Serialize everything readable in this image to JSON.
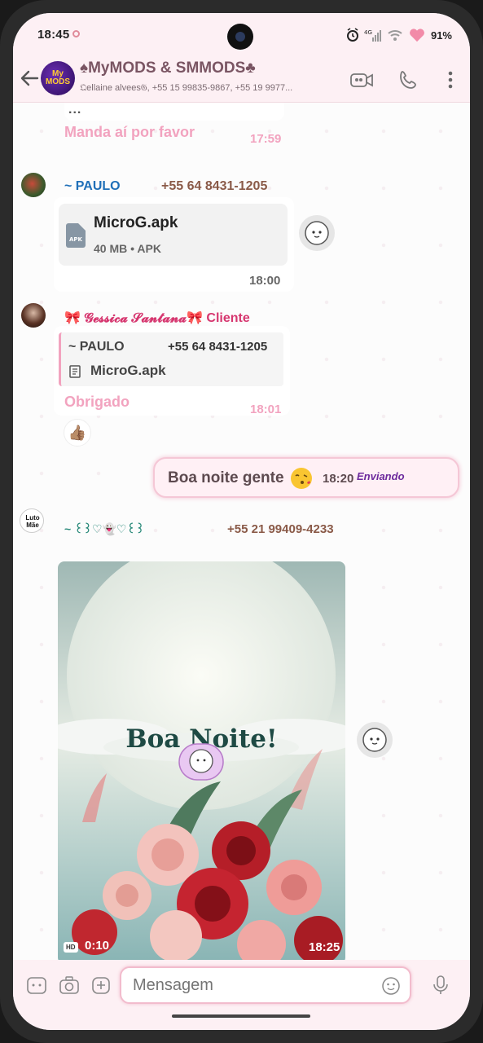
{
  "status_bar": {
    "time": "18:45",
    "battery": "91%"
  },
  "header": {
    "group_title": "♠MyMODS & SMMODS♣",
    "members": "𝔔ellaine alvees𝔊, +55 15 99835-9867, +55 19 9977...",
    "avatar_text": "My MODS"
  },
  "chat": {
    "msg1": {
      "ellipsis": "...",
      "text": "Manda aí por favor",
      "time": "17:59"
    },
    "msg2": {
      "sender": "~ PAULO",
      "phone": "+55 64 8431-1205",
      "file_name": "MicroG.apk",
      "file_meta": "40 MB • APK",
      "file_type": "APK",
      "time": "18:00"
    },
    "msg3": {
      "sender": "🎀 𝓖𝓮𝓼𝓼𝓲𝓬𝓪 𝓢𝓪𝓷𝓽𝓪𝓷𝓪🎀 Cliente",
      "quote_name": "~ PAULO",
      "quote_phone": "+55 64 8431-1205",
      "quote_doc": "MicroG.apk",
      "text": "Obrigado",
      "time": "18:01",
      "reaction": "👍🏽"
    },
    "msg4": {
      "text": "Boa noite gente",
      "time": "18:20",
      "status": "Enviando"
    },
    "msg5": {
      "sender": "~ ꒰꒱♡👻♡꒰꒱",
      "phone": "+55 21 99409-4233",
      "avatar_text": "Luto Mãe",
      "image_caption": "Boa Noite!",
      "hd": "HD",
      "duration": "0:10",
      "time": "18:25"
    }
  },
  "input": {
    "placeholder": "Mensagem"
  },
  "colors": {
    "accent_pink": "#f2a3bf",
    "paulo_blue": "#1f6fb8",
    "gessica_pink": "#d6366f",
    "teal_name": "#2a8a7a"
  }
}
